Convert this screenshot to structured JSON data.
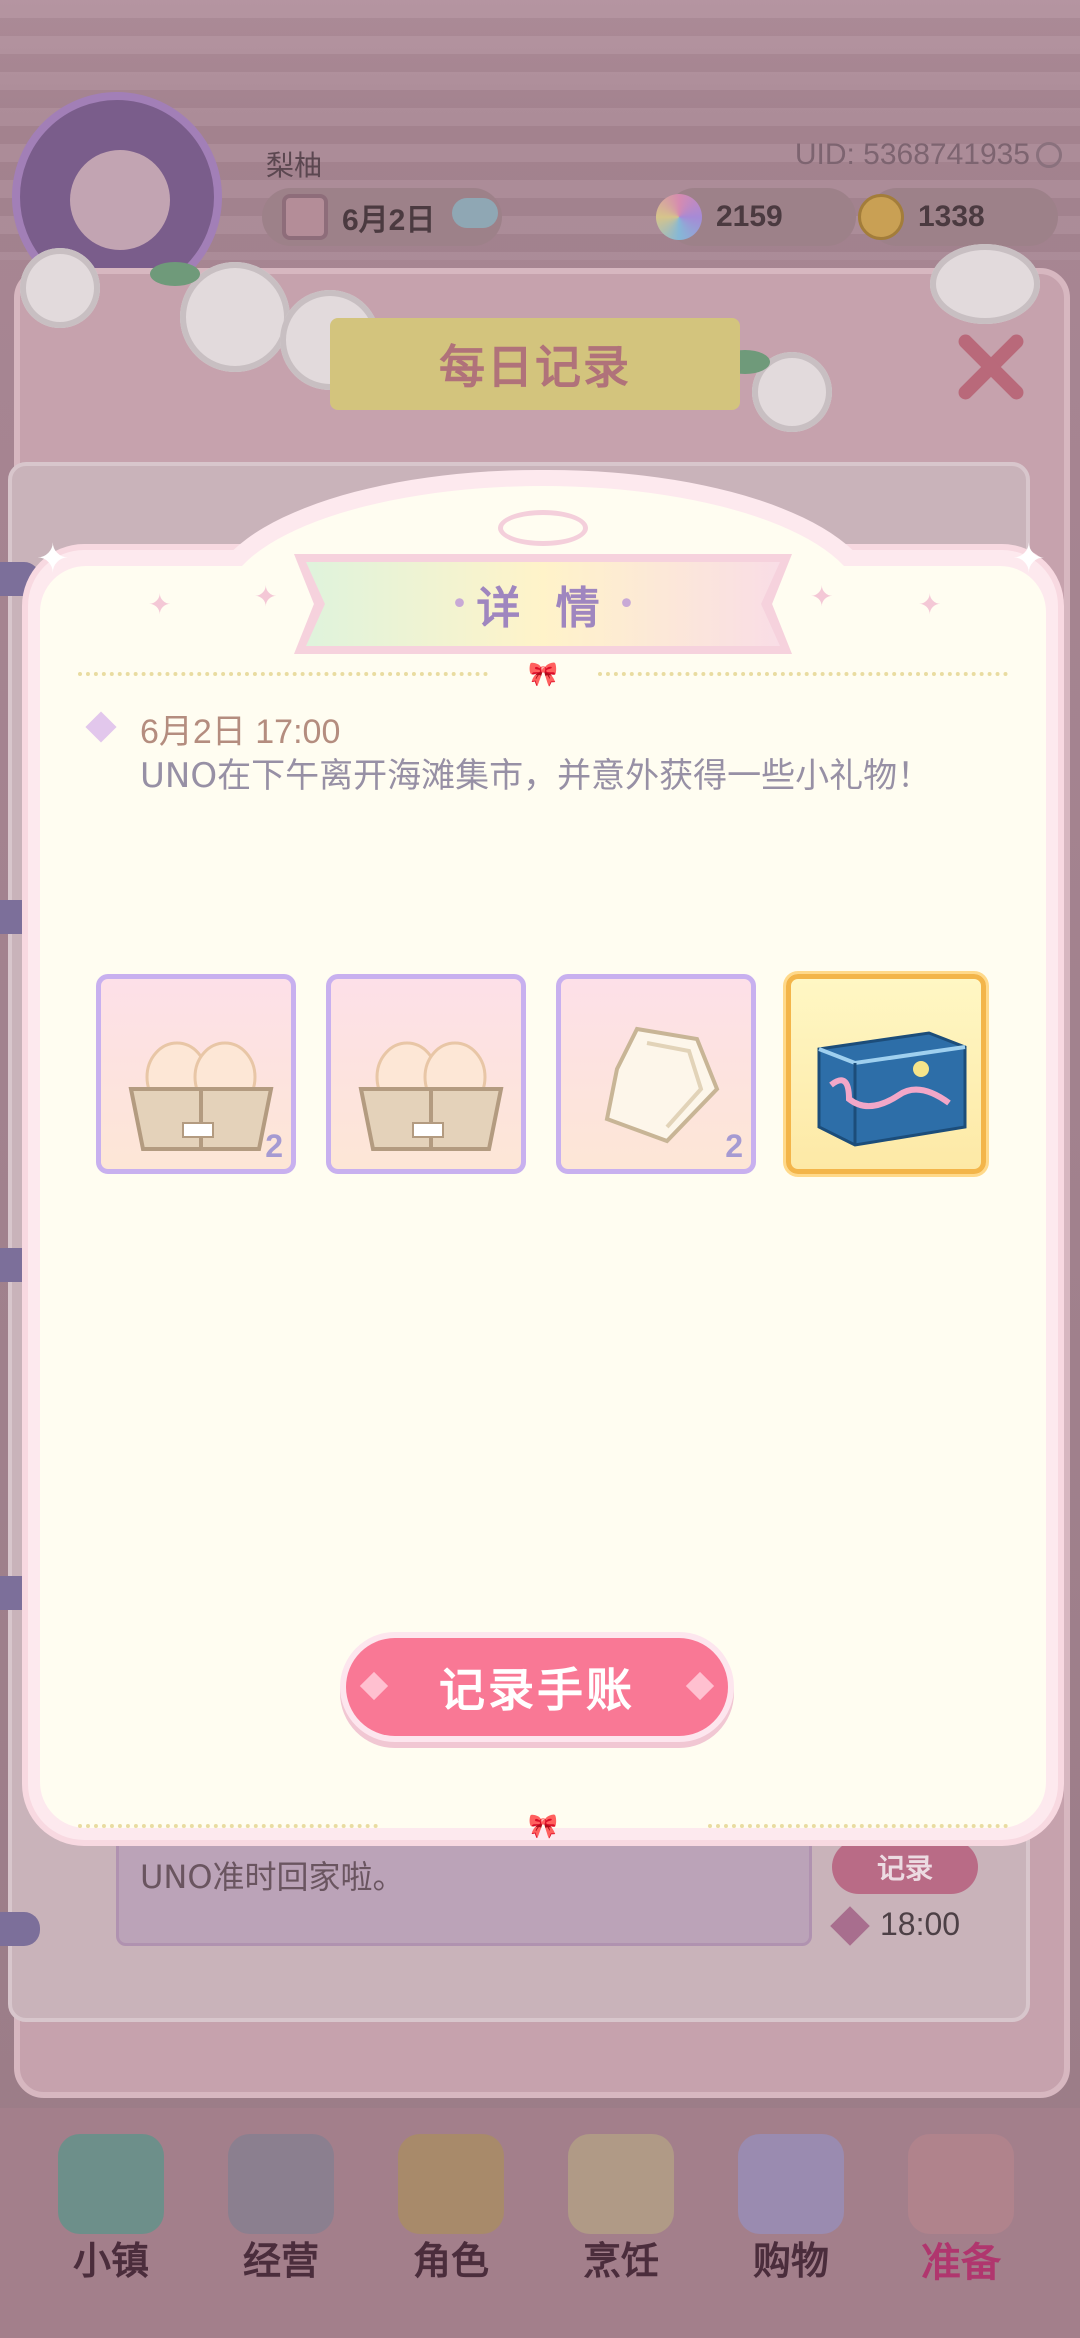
{
  "header": {
    "player_name": "梨柚",
    "uid": "UID: 5368741935",
    "date": "6月2日",
    "gems": "2159",
    "coins": "1338"
  },
  "record_panel": {
    "title": "每日记录",
    "entry_text": "UNO准时回家啦。",
    "entry_button": "记录",
    "entry_time": "18:00"
  },
  "dialog": {
    "title": "详 情",
    "log_time": "6月2日 17:00",
    "log_text": "UNO在下午离开海滩集市，并意外获得一些小礼物！",
    "rewards": [
      {
        "icon": "egg-tray-icon",
        "count": "2"
      },
      {
        "icon": "egg-tray-icon",
        "count": ""
      },
      {
        "icon": "tissue-icon",
        "count": "2"
      },
      {
        "icon": "gift-box-icon",
        "count": ""
      }
    ],
    "button": "记录手账"
  },
  "nav": {
    "items": [
      {
        "label": "小镇",
        "icon": "map-icon"
      },
      {
        "label": "经营",
        "icon": "shop-bag-icon"
      },
      {
        "label": "角色",
        "icon": "character-icon"
      },
      {
        "label": "烹饪",
        "icon": "sandwich-icon"
      },
      {
        "label": "购物",
        "icon": "shopping-bag-icon"
      },
      {
        "label": "准备",
        "icon": "basket-icon"
      }
    ],
    "active": "准备"
  },
  "colors": {
    "primary_button": "#f97895",
    "dialog_bg": "#fffdf1",
    "dialog_border": "#fde9ee",
    "title_text": "#9f86bf"
  }
}
